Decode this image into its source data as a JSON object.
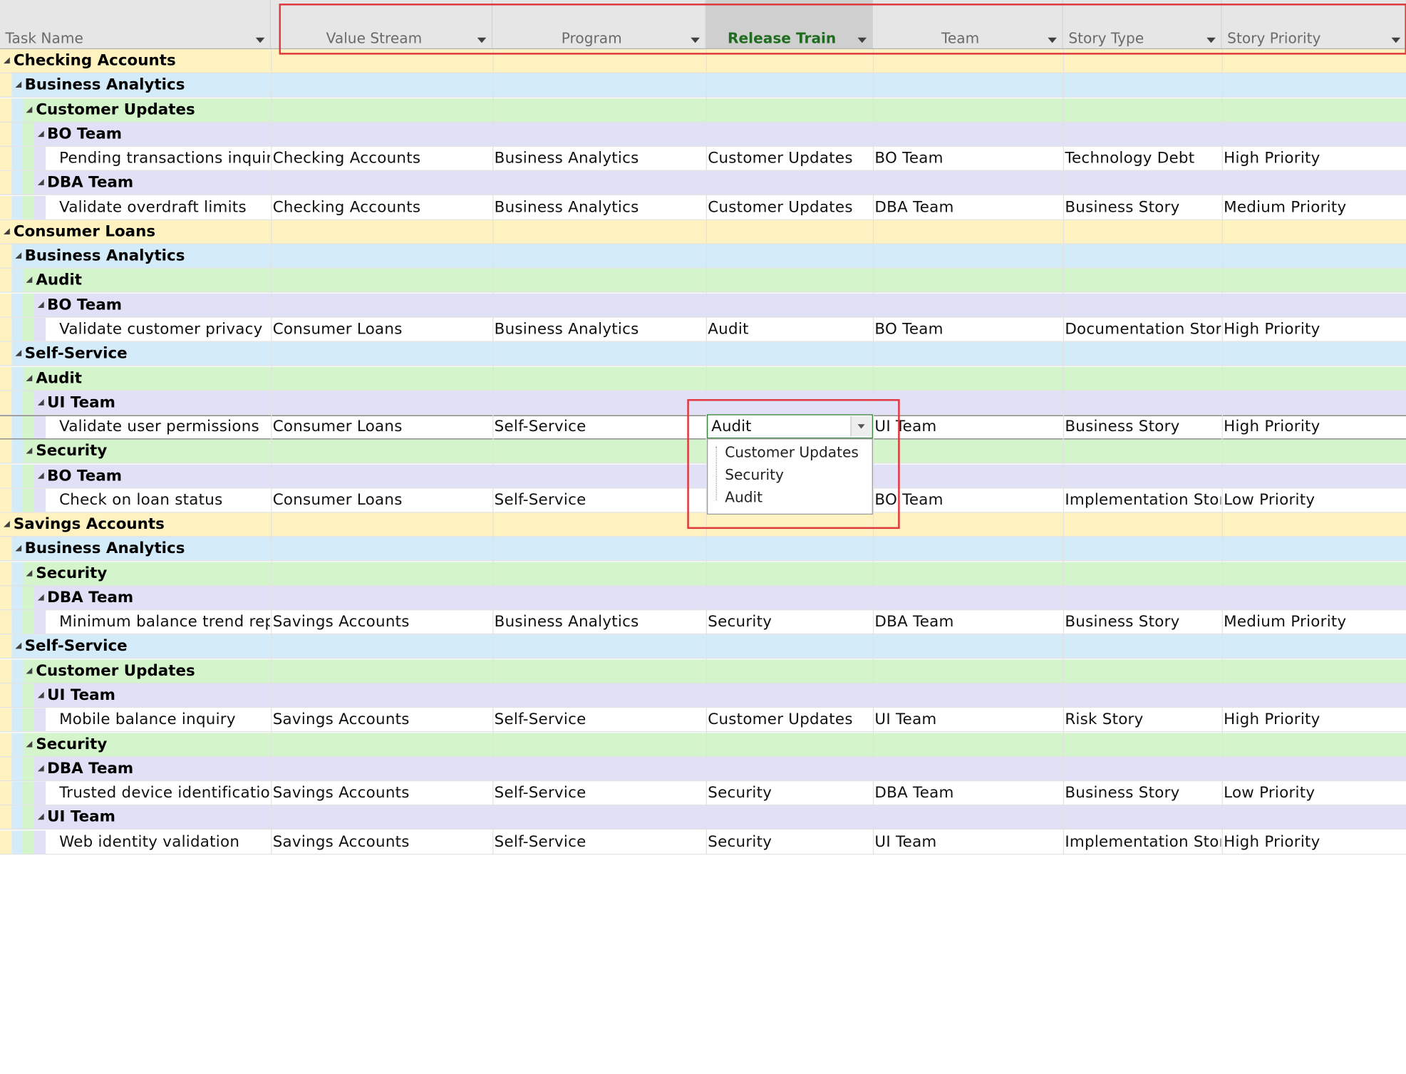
{
  "columns": [
    {
      "id": "task",
      "label": "Task Name"
    },
    {
      "id": "value_stream",
      "label": "Value Stream"
    },
    {
      "id": "program",
      "label": "Program"
    },
    {
      "id": "release_train",
      "label": "Release Train",
      "selected": true
    },
    {
      "id": "team",
      "label": "Team"
    },
    {
      "id": "story_type",
      "label": "Story Type"
    },
    {
      "id": "story_priority",
      "label": "Story Priority"
    }
  ],
  "rows": [
    {
      "level": 0,
      "label": "Checking Accounts"
    },
    {
      "level": 1,
      "label": "Business Analytics"
    },
    {
      "level": 2,
      "label": "Customer Updates"
    },
    {
      "level": 3,
      "label": "BO Team"
    },
    {
      "level": 4,
      "cells": [
        "Pending transactions inquir",
        "Checking Accounts",
        "Business Analytics",
        "Customer Updates",
        "BO Team",
        "Technology Debt",
        "High Priority"
      ]
    },
    {
      "level": 3,
      "label": "DBA Team"
    },
    {
      "level": 4,
      "cells": [
        "Validate overdraft limits",
        "Checking Accounts",
        "Business Analytics",
        "Customer Updates",
        "DBA Team",
        "Business Story",
        "Medium Priority"
      ]
    },
    {
      "level": 0,
      "label": "Consumer Loans"
    },
    {
      "level": 1,
      "label": "Business Analytics"
    },
    {
      "level": 2,
      "label": "Audit"
    },
    {
      "level": 3,
      "label": "BO Team"
    },
    {
      "level": 4,
      "cells": [
        "Validate customer privacy",
        "Consumer Loans",
        "Business Analytics",
        "Audit",
        "BO Team",
        "Documentation Stor",
        "High Priority"
      ]
    },
    {
      "level": 1,
      "label": "Self-Service"
    },
    {
      "level": 2,
      "label": "Audit"
    },
    {
      "level": 3,
      "label": "UI Team"
    },
    {
      "level": 4,
      "editing": true,
      "cells": [
        "Validate user permissions",
        "Consumer Loans",
        "Self-Service",
        "",
        "UI Team",
        "Business Story",
        "High Priority"
      ]
    },
    {
      "level": 2,
      "label": "Security"
    },
    {
      "level": 3,
      "label": "BO Team"
    },
    {
      "level": 4,
      "cells": [
        "Check on loan status",
        "Consumer Loans",
        "Self-Service",
        "",
        "BO Team",
        "Implementation Stor",
        "Low Priority"
      ]
    },
    {
      "level": 0,
      "label": "Savings Accounts"
    },
    {
      "level": 1,
      "label": "Business Analytics"
    },
    {
      "level": 2,
      "label": "Security"
    },
    {
      "level": 3,
      "label": "DBA Team"
    },
    {
      "level": 4,
      "cells": [
        "Minimum balance trend rep",
        "Savings Accounts",
        "Business Analytics",
        "Security",
        "DBA Team",
        "Business Story",
        "Medium Priority"
      ]
    },
    {
      "level": 1,
      "label": "Self-Service"
    },
    {
      "level": 2,
      "label": "Customer Updates"
    },
    {
      "level": 3,
      "label": "UI Team"
    },
    {
      "level": 4,
      "cells": [
        "Mobile balance inquiry",
        "Savings Accounts",
        "Self-Service",
        "Customer Updates",
        "UI Team",
        "Risk Story",
        "High Priority"
      ]
    },
    {
      "level": 2,
      "label": "Security"
    },
    {
      "level": 3,
      "label": "DBA Team"
    },
    {
      "level": 4,
      "cells": [
        "Trusted device identificatio",
        "Savings Accounts",
        "Self-Service",
        "Security",
        "DBA Team",
        "Business Story",
        "Low Priority"
      ]
    },
    {
      "level": 3,
      "label": "UI Team"
    },
    {
      "level": 4,
      "cells": [
        "Web identity validation",
        "Savings Accounts",
        "Self-Service",
        "Security",
        "UI Team",
        "Implementation Stor",
        "High Priority"
      ]
    }
  ],
  "dropdown": {
    "current_value": "Audit",
    "options": [
      "Customer Updates",
      "Security",
      "Audit"
    ]
  },
  "colors": {
    "level0": "#fff2c1",
    "level1": "#d4ebfa",
    "level2": "#d4f4cc",
    "level3": "#e0e0f6",
    "highlight": "#e0393e",
    "selected_header_text": "#1f6b1f"
  }
}
